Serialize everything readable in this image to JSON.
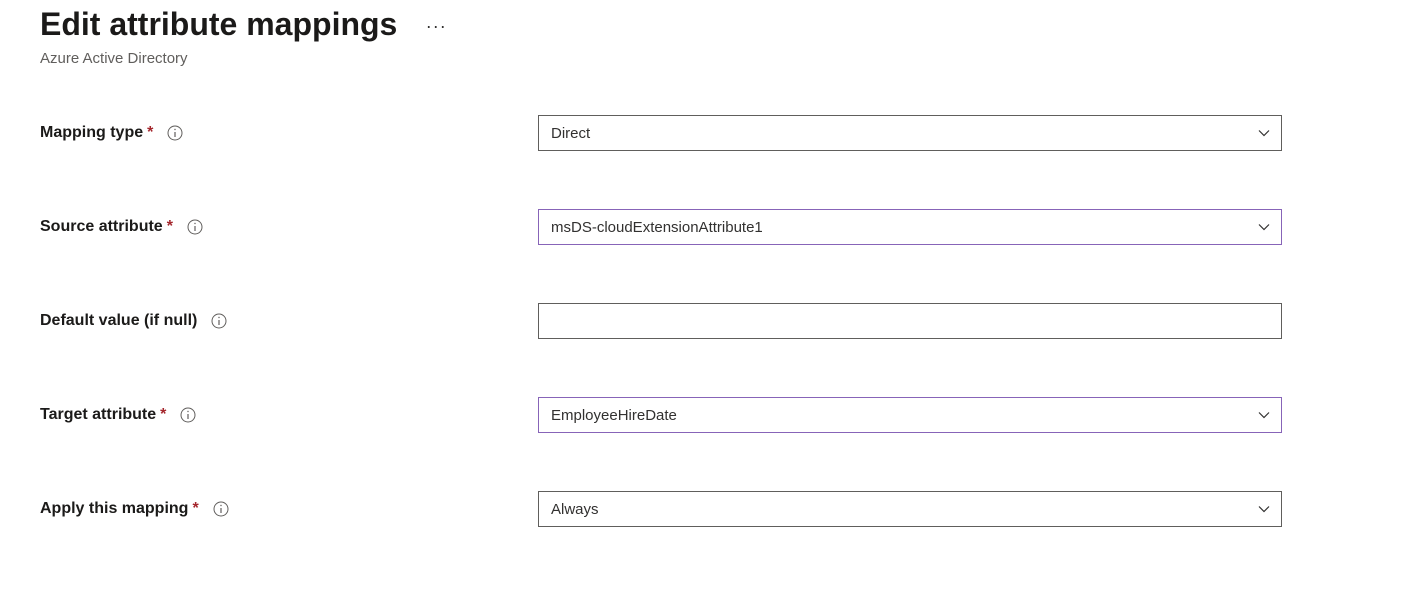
{
  "header": {
    "title": "Edit attribute mappings",
    "subtitle": "Azure Active Directory"
  },
  "fields": {
    "mapping_type": {
      "label": "Mapping type",
      "value": "Direct",
      "required": true
    },
    "source_attribute": {
      "label": "Source attribute",
      "value": "msDS-cloudExtensionAttribute1",
      "required": true
    },
    "default_value": {
      "label": "Default value (if null)",
      "value": "",
      "required": false
    },
    "target_attribute": {
      "label": "Target attribute",
      "value": "EmployeeHireDate",
      "required": true
    },
    "apply_mapping": {
      "label": "Apply this mapping",
      "value": "Always",
      "required": true
    }
  }
}
